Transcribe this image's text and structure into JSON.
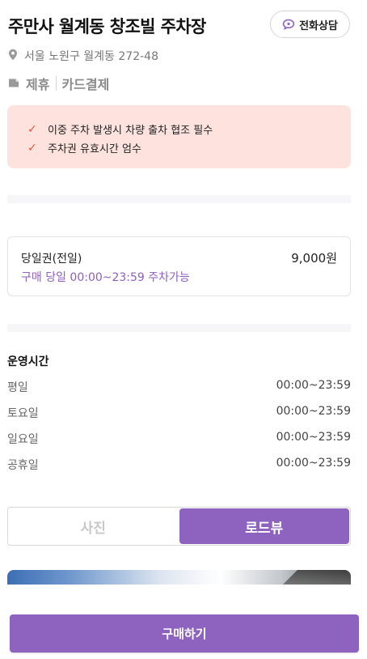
{
  "header": {
    "title": "주만사 월계동 창조빌 주차장",
    "call_button_label": "전화상담",
    "address": "서울 노원구 월계동 272-48"
  },
  "tags": [
    "제휴",
    "카드결제"
  ],
  "notice": {
    "items": [
      "이중 주차 발생시 차량 출차 협조 필수",
      "주차권 유효시간 엄수"
    ]
  },
  "ticket": {
    "name": "당일권(전일)",
    "price": "9,000원",
    "description": "구매 당일 00:00~23:59 주차가능"
  },
  "hours": {
    "title": "운영시간",
    "rows": [
      {
        "day": "평일",
        "time": "00:00~23:59"
      },
      {
        "day": "토요일",
        "time": "00:00~23:59"
      },
      {
        "day": "일요일",
        "time": "00:00~23:59"
      },
      {
        "day": "공휴일",
        "time": "00:00~23:59"
      }
    ]
  },
  "media_tabs": {
    "photo": "사진",
    "roadview": "로드뷰",
    "selected": "로드뷰"
  },
  "buy_button": "구매하기",
  "colors": {
    "accent": "#8e63bf",
    "notice_bg": "#fde2de",
    "check": "#e8543c"
  }
}
